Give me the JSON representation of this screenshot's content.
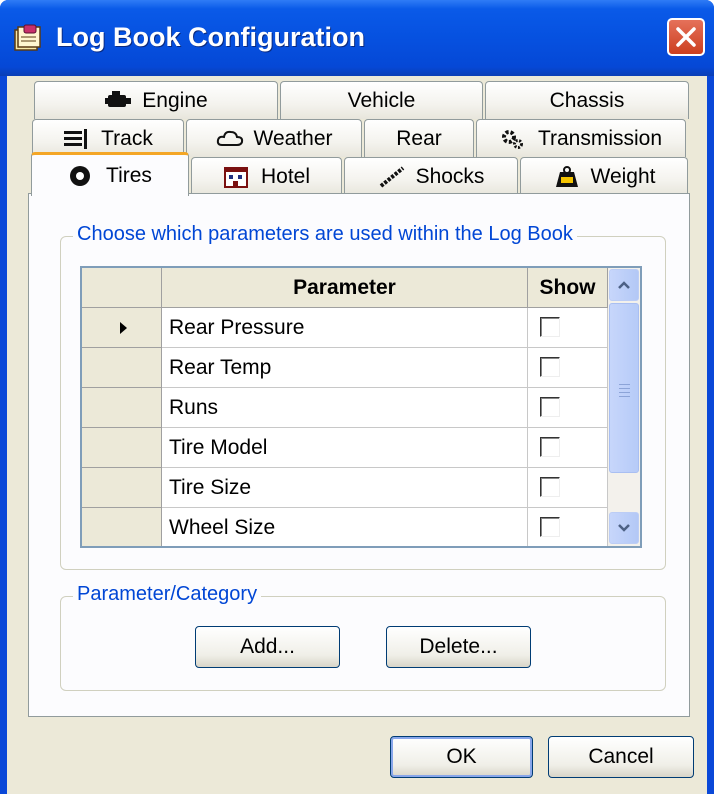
{
  "window": {
    "title": "Log Book Configuration"
  },
  "tabs": {
    "row1": [
      {
        "label": "Engine",
        "icon": "engine-icon"
      },
      {
        "label": "Vehicle"
      },
      {
        "label": "Chassis"
      }
    ],
    "row2": [
      {
        "label": "Track",
        "icon": "track-icon"
      },
      {
        "label": "Weather",
        "icon": "cloud-icon"
      },
      {
        "label": "Rear"
      },
      {
        "label": "Transmission",
        "icon": "gears-icon"
      }
    ],
    "row3": [
      {
        "label": "Tires",
        "icon": "tire-icon",
        "active": true
      },
      {
        "label": "Hotel",
        "icon": "building-icon"
      },
      {
        "label": "Shocks",
        "icon": "shock-icon"
      },
      {
        "label": "Weight",
        "icon": "weight-icon"
      }
    ]
  },
  "params_group": {
    "legend": "Choose which parameters are  used within the Log Book",
    "columns": {
      "parameter": "Parameter",
      "show": "Show"
    },
    "rows": [
      {
        "name": "Rear Pressure",
        "show": false,
        "current": true
      },
      {
        "name": "Rear Temp",
        "show": false
      },
      {
        "name": "Runs",
        "show": false
      },
      {
        "name": "Tire Model",
        "show": false
      },
      {
        "name": "Tire Size",
        "show": false
      },
      {
        "name": "Wheel Size",
        "show": false
      }
    ]
  },
  "category_group": {
    "legend": "Parameter/Category",
    "add_label": "Add...",
    "delete_label": "Delete..."
  },
  "footer": {
    "ok_label": "OK",
    "cancel_label": "Cancel"
  },
  "colors": {
    "titlebar": "#0a5ae8",
    "active_tab_accent": "#f4a626",
    "legend_text": "#0046d5",
    "face": "#ece9d8"
  }
}
